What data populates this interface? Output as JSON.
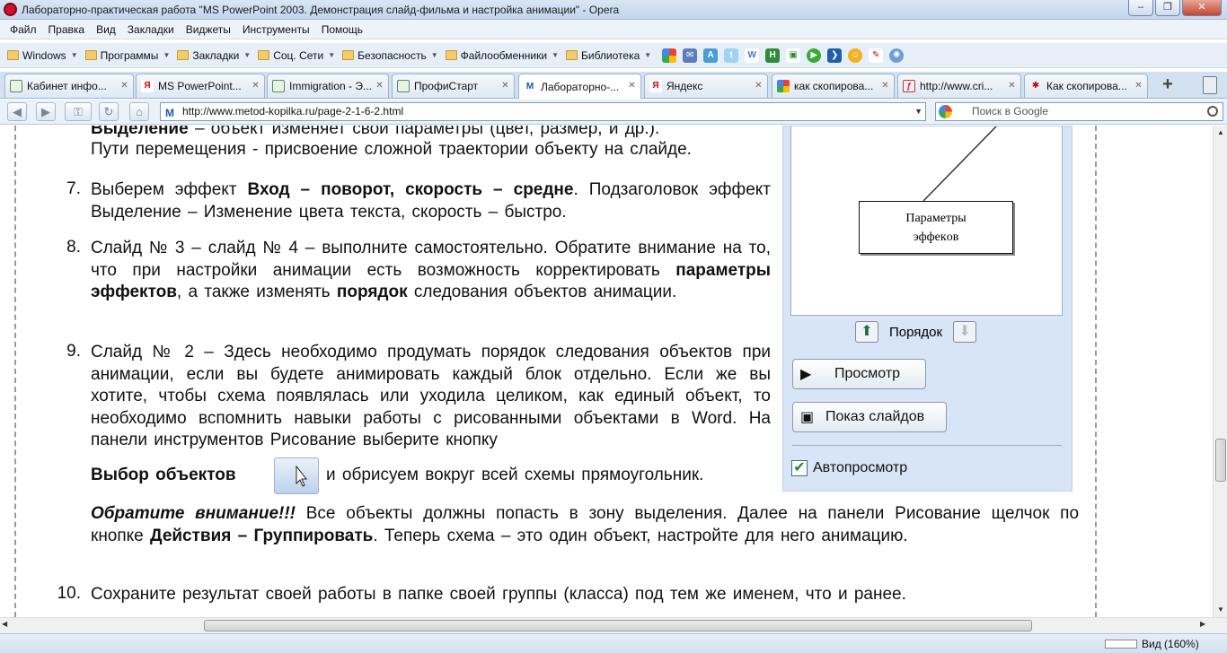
{
  "window": {
    "title": "Лабораторно-практическая работа \"MS PowerPoint 2003. Демонстрация слайд-фильма и настройка анимации\" - Opera",
    "minimize": "‒",
    "maximize": "❐",
    "close": "✕"
  },
  "menu": [
    "Файл",
    "Правка",
    "Вид",
    "Закладки",
    "Виджеты",
    "Инструменты",
    "Помощь"
  ],
  "bookmarks": {
    "folders": [
      "Windows",
      "Программы",
      "Закладки",
      "Соц. Сети",
      "Безопасность",
      "Файлообменники",
      "Библиотека"
    ]
  },
  "tabs": [
    {
      "label": "Кабинет инфо...",
      "icon": "page-icon"
    },
    {
      "label": "MS PowerPoint...",
      "icon": "yandex-icon"
    },
    {
      "label": "Immigration - Э...",
      "icon": "page-icon"
    },
    {
      "label": "ПрофиСтарт",
      "icon": "page-icon"
    },
    {
      "label": "Лабораторно-...",
      "icon": "metod-icon"
    },
    {
      "label": "Яндекс",
      "icon": "yandex-icon"
    },
    {
      "label": "как скопирова...",
      "icon": "google-icon"
    },
    {
      "label": "http://www.cri...",
      "icon": "flash-icon"
    },
    {
      "label": "Как скопирова...",
      "icon": "bug-icon"
    }
  ],
  "address": {
    "url": "http://www.metod-kopilka.ru/page-2-1-6-2.html",
    "search_placeholder": "Поиск в Google"
  },
  "article": {
    "top_cut_bold": "Выделение",
    "top_cut_rest": " – объект изменяет свои параметры (цвет, размер, и др.).",
    "top_line2": "Пути перемещения - присвоение сложной траектории объекту на слайде.",
    "items": [
      {
        "num": "7.",
        "pre": "Выберем эффект ",
        "bold": "Вход – поворот, скорость – средне",
        "post": ". Подзаголовок эффект Выделение – Изменение цвета текста, скорость – быстро."
      },
      {
        "num": "8.",
        "pre": "Слайд № 3 – слайд № 4 – выполните самостоятельно. Обратите внимание на то, что при настройки анимации есть возможность корректировать ",
        "bold": "параметры эффектов",
        "mid": ", а также изменять ",
        "bold2": "порядок",
        "post": " следования объектов анимации."
      },
      {
        "num": "9.",
        "text": "Слайд № 2 – Здесь необходимо продумать порядок следования объектов при анимации, если вы будете анимировать каждый блок отдельно. Если же вы хотите, чтобы схема появлялась или уходила целиком, как единый объект, то необходимо вспомнить навыки работы с рисованными объектами в Word. На панели инструментов Рисование выберите кнопку",
        "sel_bold": "Выбор объектов",
        "sel_post": "и обрисуем вокруг всей схемы прямоугольник.",
        "note_italic": "Обратите внимание!!!",
        "note_text": " Все объекты должны попасть в зону  выделения. Далее на панели Рисование щелчок по кнопке ",
        "note_bold": "Действия – Группировать",
        "note_post": ". Теперь схема – это один объект, настройте для него анимацию."
      },
      {
        "num": "10.",
        "text": "Сохраните результат своей работы в папке своей группы (класса) под тем же именем, что и ранее."
      }
    ]
  },
  "panel": {
    "callout_line1": "Параметры",
    "callout_line2": "эффекoв",
    "order_label": "Порядок",
    "preview_button": "Просмотр",
    "slideshow_button": "Показ слайдов",
    "autopreview_label": "Автопросмотр",
    "autopreview_checked": true
  },
  "status": {
    "zoom": "Вид (160%)"
  }
}
